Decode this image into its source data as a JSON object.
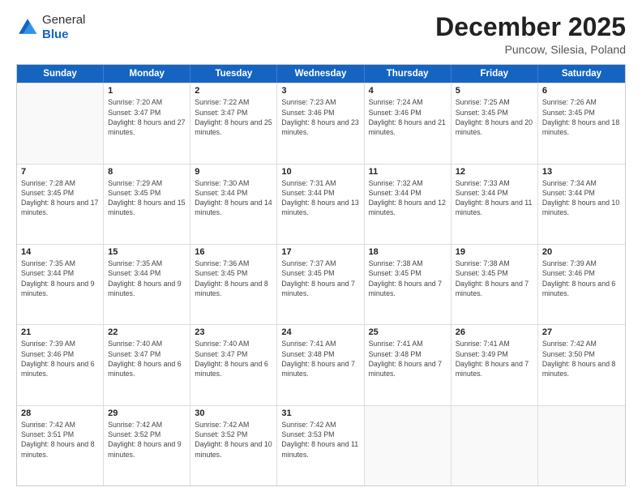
{
  "logo": {
    "general": "General",
    "blue": "Blue"
  },
  "title": "December 2025",
  "subtitle": "Puncow, Silesia, Poland",
  "days": [
    "Sunday",
    "Monday",
    "Tuesday",
    "Wednesday",
    "Thursday",
    "Friday",
    "Saturday"
  ],
  "weeks": [
    [
      {
        "day": "",
        "sunrise": "",
        "sunset": "",
        "daylight": "",
        "empty": true
      },
      {
        "day": "1",
        "sunrise": "Sunrise: 7:20 AM",
        "sunset": "Sunset: 3:47 PM",
        "daylight": "Daylight: 8 hours and 27 minutes."
      },
      {
        "day": "2",
        "sunrise": "Sunrise: 7:22 AM",
        "sunset": "Sunset: 3:47 PM",
        "daylight": "Daylight: 8 hours and 25 minutes."
      },
      {
        "day": "3",
        "sunrise": "Sunrise: 7:23 AM",
        "sunset": "Sunset: 3:46 PM",
        "daylight": "Daylight: 8 hours and 23 minutes."
      },
      {
        "day": "4",
        "sunrise": "Sunrise: 7:24 AM",
        "sunset": "Sunset: 3:46 PM",
        "daylight": "Daylight: 8 hours and 21 minutes."
      },
      {
        "day": "5",
        "sunrise": "Sunrise: 7:25 AM",
        "sunset": "Sunset: 3:45 PM",
        "daylight": "Daylight: 8 hours and 20 minutes."
      },
      {
        "day": "6",
        "sunrise": "Sunrise: 7:26 AM",
        "sunset": "Sunset: 3:45 PM",
        "daylight": "Daylight: 8 hours and 18 minutes."
      }
    ],
    [
      {
        "day": "7",
        "sunrise": "Sunrise: 7:28 AM",
        "sunset": "Sunset: 3:45 PM",
        "daylight": "Daylight: 8 hours and 17 minutes."
      },
      {
        "day": "8",
        "sunrise": "Sunrise: 7:29 AM",
        "sunset": "Sunset: 3:45 PM",
        "daylight": "Daylight: 8 hours and 15 minutes."
      },
      {
        "day": "9",
        "sunrise": "Sunrise: 7:30 AM",
        "sunset": "Sunset: 3:44 PM",
        "daylight": "Daylight: 8 hours and 14 minutes."
      },
      {
        "day": "10",
        "sunrise": "Sunrise: 7:31 AM",
        "sunset": "Sunset: 3:44 PM",
        "daylight": "Daylight: 8 hours and 13 minutes."
      },
      {
        "day": "11",
        "sunrise": "Sunrise: 7:32 AM",
        "sunset": "Sunset: 3:44 PM",
        "daylight": "Daylight: 8 hours and 12 minutes."
      },
      {
        "day": "12",
        "sunrise": "Sunrise: 7:33 AM",
        "sunset": "Sunset: 3:44 PM",
        "daylight": "Daylight: 8 hours and 11 minutes."
      },
      {
        "day": "13",
        "sunrise": "Sunrise: 7:34 AM",
        "sunset": "Sunset: 3:44 PM",
        "daylight": "Daylight: 8 hours and 10 minutes."
      }
    ],
    [
      {
        "day": "14",
        "sunrise": "Sunrise: 7:35 AM",
        "sunset": "Sunset: 3:44 PM",
        "daylight": "Daylight: 8 hours and 9 minutes."
      },
      {
        "day": "15",
        "sunrise": "Sunrise: 7:35 AM",
        "sunset": "Sunset: 3:44 PM",
        "daylight": "Daylight: 8 hours and 9 minutes."
      },
      {
        "day": "16",
        "sunrise": "Sunrise: 7:36 AM",
        "sunset": "Sunset: 3:45 PM",
        "daylight": "Daylight: 8 hours and 8 minutes."
      },
      {
        "day": "17",
        "sunrise": "Sunrise: 7:37 AM",
        "sunset": "Sunset: 3:45 PM",
        "daylight": "Daylight: 8 hours and 7 minutes."
      },
      {
        "day": "18",
        "sunrise": "Sunrise: 7:38 AM",
        "sunset": "Sunset: 3:45 PM",
        "daylight": "Daylight: 8 hours and 7 minutes."
      },
      {
        "day": "19",
        "sunrise": "Sunrise: 7:38 AM",
        "sunset": "Sunset: 3:45 PM",
        "daylight": "Daylight: 8 hours and 7 minutes."
      },
      {
        "day": "20",
        "sunrise": "Sunrise: 7:39 AM",
        "sunset": "Sunset: 3:46 PM",
        "daylight": "Daylight: 8 hours and 6 minutes."
      }
    ],
    [
      {
        "day": "21",
        "sunrise": "Sunrise: 7:39 AM",
        "sunset": "Sunset: 3:46 PM",
        "daylight": "Daylight: 8 hours and 6 minutes."
      },
      {
        "day": "22",
        "sunrise": "Sunrise: 7:40 AM",
        "sunset": "Sunset: 3:47 PM",
        "daylight": "Daylight: 8 hours and 6 minutes."
      },
      {
        "day": "23",
        "sunrise": "Sunrise: 7:40 AM",
        "sunset": "Sunset: 3:47 PM",
        "daylight": "Daylight: 8 hours and 6 minutes."
      },
      {
        "day": "24",
        "sunrise": "Sunrise: 7:41 AM",
        "sunset": "Sunset: 3:48 PM",
        "daylight": "Daylight: 8 hours and 7 minutes."
      },
      {
        "day": "25",
        "sunrise": "Sunrise: 7:41 AM",
        "sunset": "Sunset: 3:48 PM",
        "daylight": "Daylight: 8 hours and 7 minutes."
      },
      {
        "day": "26",
        "sunrise": "Sunrise: 7:41 AM",
        "sunset": "Sunset: 3:49 PM",
        "daylight": "Daylight: 8 hours and 7 minutes."
      },
      {
        "day": "27",
        "sunrise": "Sunrise: 7:42 AM",
        "sunset": "Sunset: 3:50 PM",
        "daylight": "Daylight: 8 hours and 8 minutes."
      }
    ],
    [
      {
        "day": "28",
        "sunrise": "Sunrise: 7:42 AM",
        "sunset": "Sunset: 3:51 PM",
        "daylight": "Daylight: 8 hours and 8 minutes."
      },
      {
        "day": "29",
        "sunrise": "Sunrise: 7:42 AM",
        "sunset": "Sunset: 3:52 PM",
        "daylight": "Daylight: 8 hours and 9 minutes."
      },
      {
        "day": "30",
        "sunrise": "Sunrise: 7:42 AM",
        "sunset": "Sunset: 3:52 PM",
        "daylight": "Daylight: 8 hours and 10 minutes."
      },
      {
        "day": "31",
        "sunrise": "Sunrise: 7:42 AM",
        "sunset": "Sunset: 3:53 PM",
        "daylight": "Daylight: 8 hours and 11 minutes."
      },
      {
        "day": "",
        "sunrise": "",
        "sunset": "",
        "daylight": "",
        "empty": true
      },
      {
        "day": "",
        "sunrise": "",
        "sunset": "",
        "daylight": "",
        "empty": true
      },
      {
        "day": "",
        "sunrise": "",
        "sunset": "",
        "daylight": "",
        "empty": true
      }
    ]
  ]
}
